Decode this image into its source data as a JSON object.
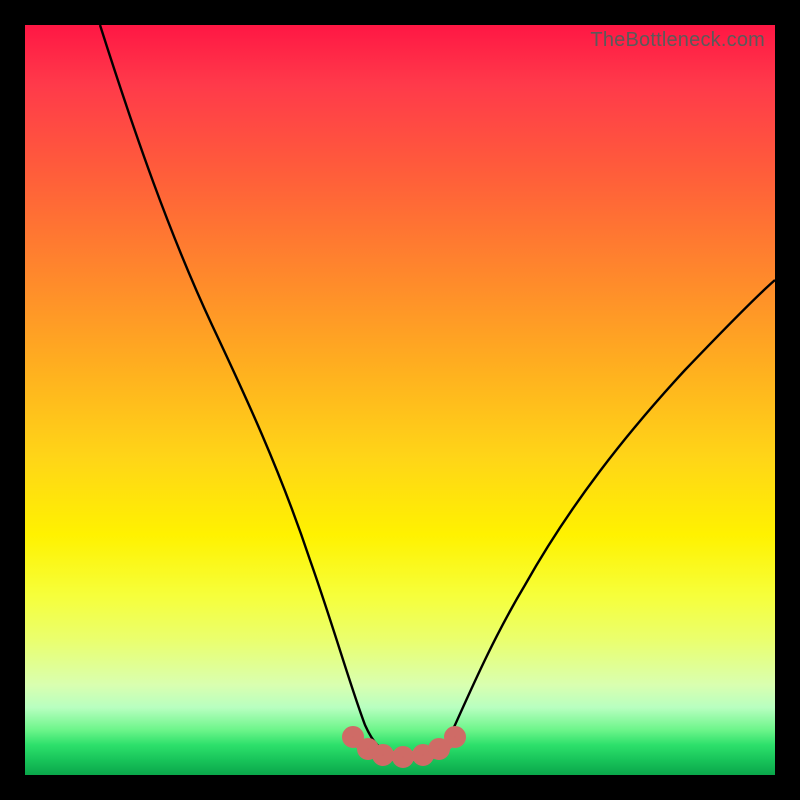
{
  "watermark": {
    "text": "TheBottleneck.com"
  },
  "colors": {
    "background": "#000000",
    "curve_stroke": "#000000",
    "marker_fill": "#cf6b66",
    "marker_stroke": "#cf6b66"
  },
  "chart_data": {
    "type": "line",
    "title": "",
    "xlabel": "",
    "ylabel": "",
    "xlim": [
      0,
      100
    ],
    "ylim": [
      0,
      100
    ],
    "grid": false,
    "legend": false,
    "series": [
      {
        "name": "bottleneck-curve",
        "x": [
          10,
          15,
          20,
          25,
          30,
          35,
          38,
          41,
          43,
          45,
          47,
          49,
          51,
          53,
          56,
          60,
          65,
          70,
          75,
          80,
          85,
          90,
          95,
          100
        ],
        "y": [
          100,
          86,
          73,
          60,
          47,
          34,
          25,
          16,
          10,
          6,
          4,
          3,
          3,
          4,
          8,
          14,
          22,
          29,
          36,
          43,
          49,
          55,
          60,
          65
        ]
      },
      {
        "name": "low-bottleneck-markers",
        "x": [
          43,
          45,
          47,
          49,
          51,
          53,
          55
        ],
        "y": [
          4,
          3,
          3,
          3,
          3,
          3,
          4
        ]
      }
    ]
  }
}
